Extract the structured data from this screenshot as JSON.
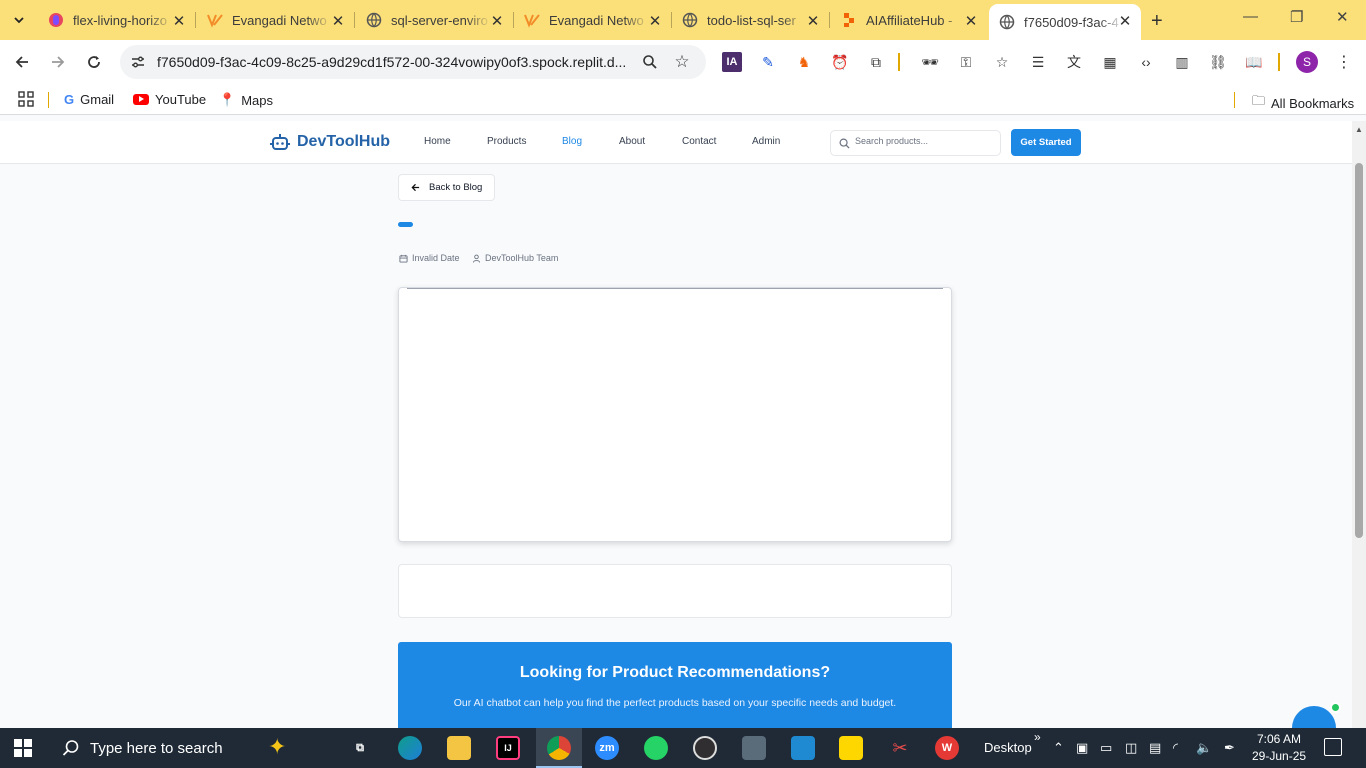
{
  "browser": {
    "tabs": [
      {
        "title": "flex-living-horizo"
      },
      {
        "title": "Evangadi Netwo"
      },
      {
        "title": "sql-server-enviro"
      },
      {
        "title": "Evangadi Netwo"
      },
      {
        "title": "todo-list-sql-ser"
      },
      {
        "title": "AIAffiliateHub - "
      },
      {
        "title": "f7650d09-f3ac-4"
      }
    ],
    "url": "f7650d09-f3ac-4c09-8c25-a9d29cd1f572-00-324vowipy0of3.spock.replit.d...",
    "profile_initial": "S",
    "ext_ia_label": "IA",
    "bookmarks": [
      {
        "label": "Gmail"
      },
      {
        "label": "YouTube"
      },
      {
        "label": "Maps"
      }
    ],
    "all_bookmarks": "All Bookmarks"
  },
  "site": {
    "brand": "DevToolHub",
    "nav": [
      {
        "label": "Home"
      },
      {
        "label": "Products"
      },
      {
        "label": "Blog"
      },
      {
        "label": "About"
      },
      {
        "label": "Contact"
      },
      {
        "label": "Admin"
      }
    ],
    "active_nav": "Blog",
    "search_placeholder": "Search products...",
    "cta_label": "Get Started",
    "accent": "#1e88e5"
  },
  "post": {
    "back_label": "Back to Blog",
    "date": "Invalid Date",
    "author": "DevToolHub Team"
  },
  "promo": {
    "title": "Looking for Product Recommendations?",
    "subtitle": "Our AI chatbot can help you find the perfect products based on your specific needs and budget."
  },
  "taskbar": {
    "search_placeholder": "Type here to search",
    "desktop_label": "Desktop",
    "zoom_label": "zm",
    "time": "7:06 AM",
    "date": "29-Jun-25"
  }
}
